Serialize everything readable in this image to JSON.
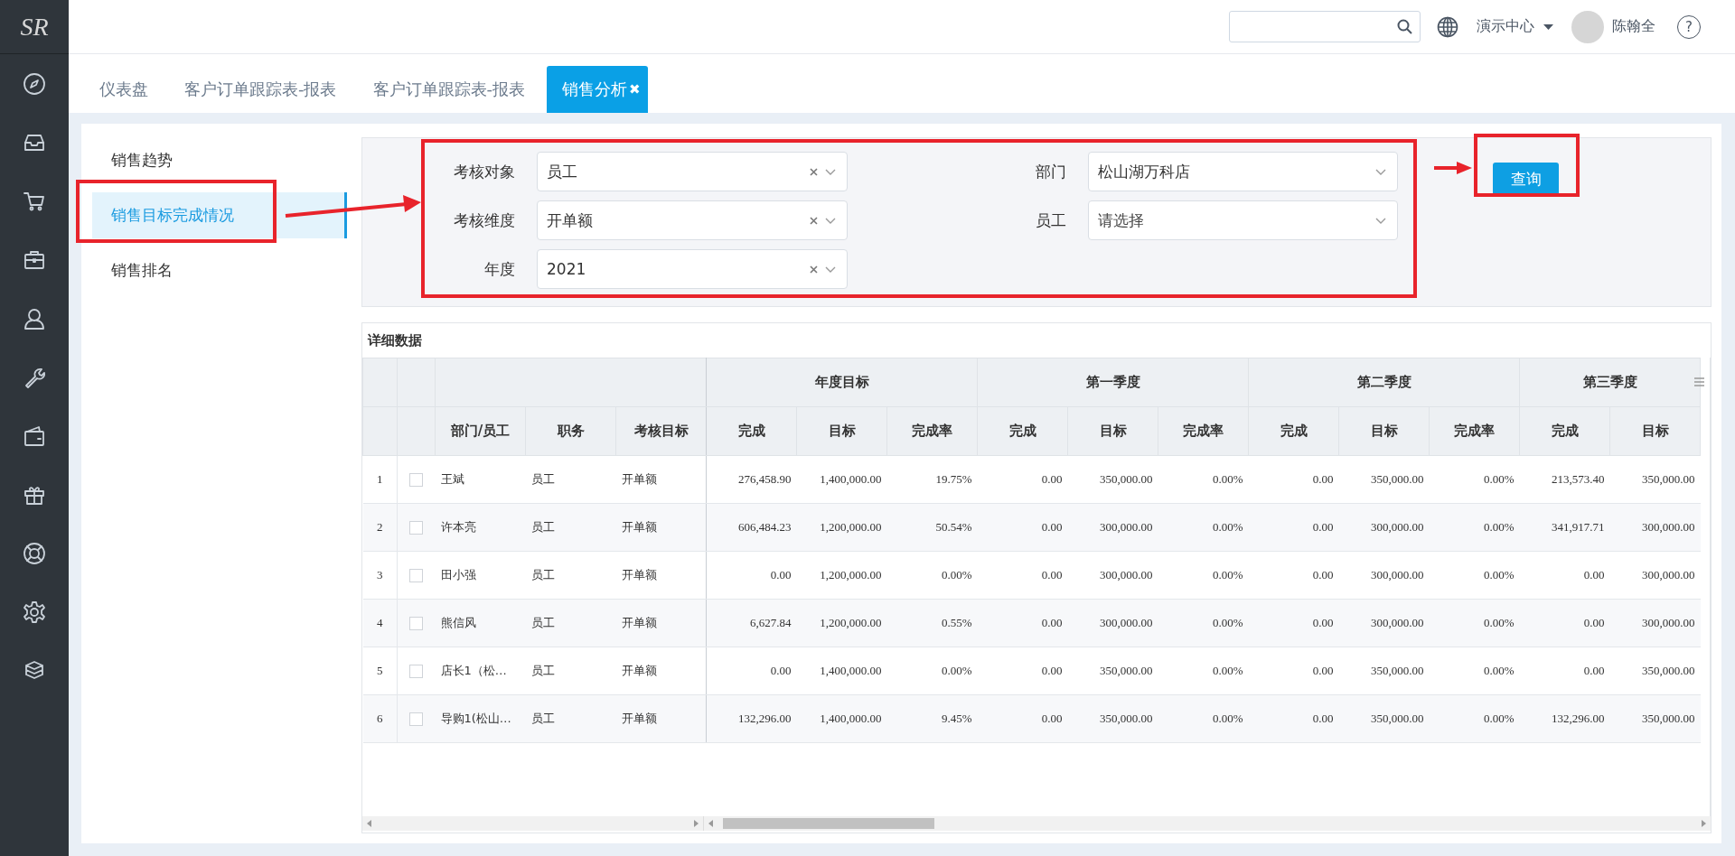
{
  "logo": "SR",
  "header": {
    "org": "演示中心",
    "user": "陈翰全",
    "help": "?"
  },
  "tabs": [
    {
      "label": "仪表盘",
      "selected": false
    },
    {
      "label": "客户订单跟踪表-报表",
      "selected": false
    },
    {
      "label": "客户订单跟踪表-报表",
      "selected": false
    },
    {
      "label": "销售分析",
      "selected": true,
      "close": "✖"
    }
  ],
  "menu": [
    {
      "label": "销售趋势",
      "selected": false
    },
    {
      "label": "销售目标完成情况",
      "selected": true
    },
    {
      "label": "销售排名",
      "selected": false
    }
  ],
  "filters": [
    {
      "label": "考核对象",
      "value": "员工",
      "clearable": true
    },
    {
      "label": "部门",
      "value": "松山湖万科店",
      "clearable": false
    },
    {
      "label": "考核维度",
      "value": "开单额",
      "clearable": true
    },
    {
      "label": "员工",
      "placeholder": "请选择",
      "clearable": false
    },
    {
      "label": "年度",
      "value": "2021",
      "clearable": true
    }
  ],
  "query_button": "查询",
  "table": {
    "title": "详细数据",
    "group_headers": [
      "年度目标",
      "第一季度",
      "第二季度",
      "第三季度"
    ],
    "columns": [
      "部门/员工",
      "职务",
      "考核目标",
      "完成",
      "目标",
      "完成率",
      "完成",
      "目标",
      "完成率",
      "完成",
      "目标",
      "完成率",
      "完成",
      "目标"
    ],
    "rows": [
      {
        "index": "1",
        "checked": false,
        "cells": [
          "王斌",
          "员工",
          "开单额",
          "276,458.90",
          "1,400,000.00",
          "19.75%",
          "0.00",
          "350,000.00",
          "0.00%",
          "0.00",
          "350,000.00",
          "0.00%",
          "213,573.40",
          "350,000.00"
        ]
      },
      {
        "index": "2",
        "checked": false,
        "cells": [
          "许本亮",
          "员工",
          "开单额",
          "606,484.23",
          "1,200,000.00",
          "50.54%",
          "0.00",
          "300,000.00",
          "0.00%",
          "0.00",
          "300,000.00",
          "0.00%",
          "341,917.71",
          "300,000.00"
        ]
      },
      {
        "index": "3",
        "checked": false,
        "cells": [
          "田小强",
          "员工",
          "开单额",
          "0.00",
          "1,200,000.00",
          "0.00%",
          "0.00",
          "300,000.00",
          "0.00%",
          "0.00",
          "300,000.00",
          "0.00%",
          "0.00",
          "300,000.00"
        ]
      },
      {
        "index": "4",
        "checked": false,
        "cells": [
          "熊信风",
          "员工",
          "开单额",
          "6,627.84",
          "1,200,000.00",
          "0.55%",
          "0.00",
          "300,000.00",
          "0.00%",
          "0.00",
          "300,000.00",
          "0.00%",
          "0.00",
          "300,000.00"
        ]
      },
      {
        "index": "5",
        "checked": false,
        "cells": [
          "店长1（松…",
          "员工",
          "开单额",
          "0.00",
          "1,400,000.00",
          "0.00%",
          "0.00",
          "350,000.00",
          "0.00%",
          "0.00",
          "350,000.00",
          "0.00%",
          "0.00",
          "350,000.00"
        ]
      },
      {
        "index": "6",
        "checked": false,
        "cells": [
          "导购1(松山…",
          "员工",
          "开单额",
          "132,296.00",
          "1,400,000.00",
          "9.45%",
          "0.00",
          "350,000.00",
          "0.00%",
          "0.00",
          "350,000.00",
          "0.00%",
          "132,296.00",
          "350,000.00"
        ]
      }
    ]
  }
}
